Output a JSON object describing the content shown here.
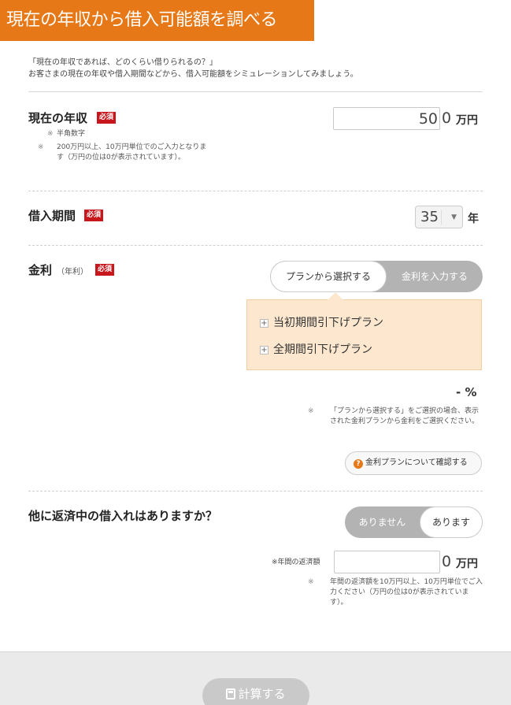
{
  "header": {
    "title": "現在の年収から借入可能額を調べる"
  },
  "intro": {
    "line1": "「現在の年収であれば、どのくらい借りられるの？」",
    "line2": "お客さまの現在の年収や借入期間などから、借入可能額をシミュレーションしてみましょう。"
  },
  "income": {
    "label": "現在の年収",
    "required": "必須",
    "note1_mark": "※",
    "note1": "半角数字",
    "note2_mark": "※",
    "note2": "200万円以上、10万円単位でのご入力となります（万円の位は0が表示されています）。",
    "value": "50",
    "suffix_zero": "0",
    "unit": "万円"
  },
  "term": {
    "label": "借入期間",
    "required": "必須",
    "selected": "35",
    "arrow": "▼",
    "unit": "年"
  },
  "rate": {
    "label": "金利",
    "sub": "（年利）",
    "required": "必須",
    "toggle": {
      "option_select_plan": "プランから選択する",
      "option_enter_rate": "金利を入力する"
    },
    "plans": [
      {
        "plus": "+",
        "label": "当初期間引下げプラン"
      },
      {
        "plus": "+",
        "label": "全期間引下げプラン"
      }
    ],
    "value": "- %",
    "note_mark": "※",
    "note": "「プランから選択する」をご選択の場合、表示された金利プランから金利をご選択ください。",
    "check_icon": "?",
    "check_button": "金利プランについて確認する"
  },
  "other_loans": {
    "label": "他に返済中の借入れはありますか？",
    "toggle": {
      "option_none": "ありません",
      "option_yes": "あります"
    },
    "annual_label": "※年間の返済額",
    "suffix_zero": "0",
    "unit": "万円",
    "note_mark": "※",
    "note": "年間の返済額を10万円以上、10万円単位でご入力ください（万円の位は0が表示されています）。"
  },
  "footer": {
    "calc_button": "計算する"
  },
  "colors": {
    "accent": "#e67817",
    "required_badge": "#c8161d",
    "plan_panel": "#fde8cf",
    "toggle_off": "#b3b3b3"
  }
}
